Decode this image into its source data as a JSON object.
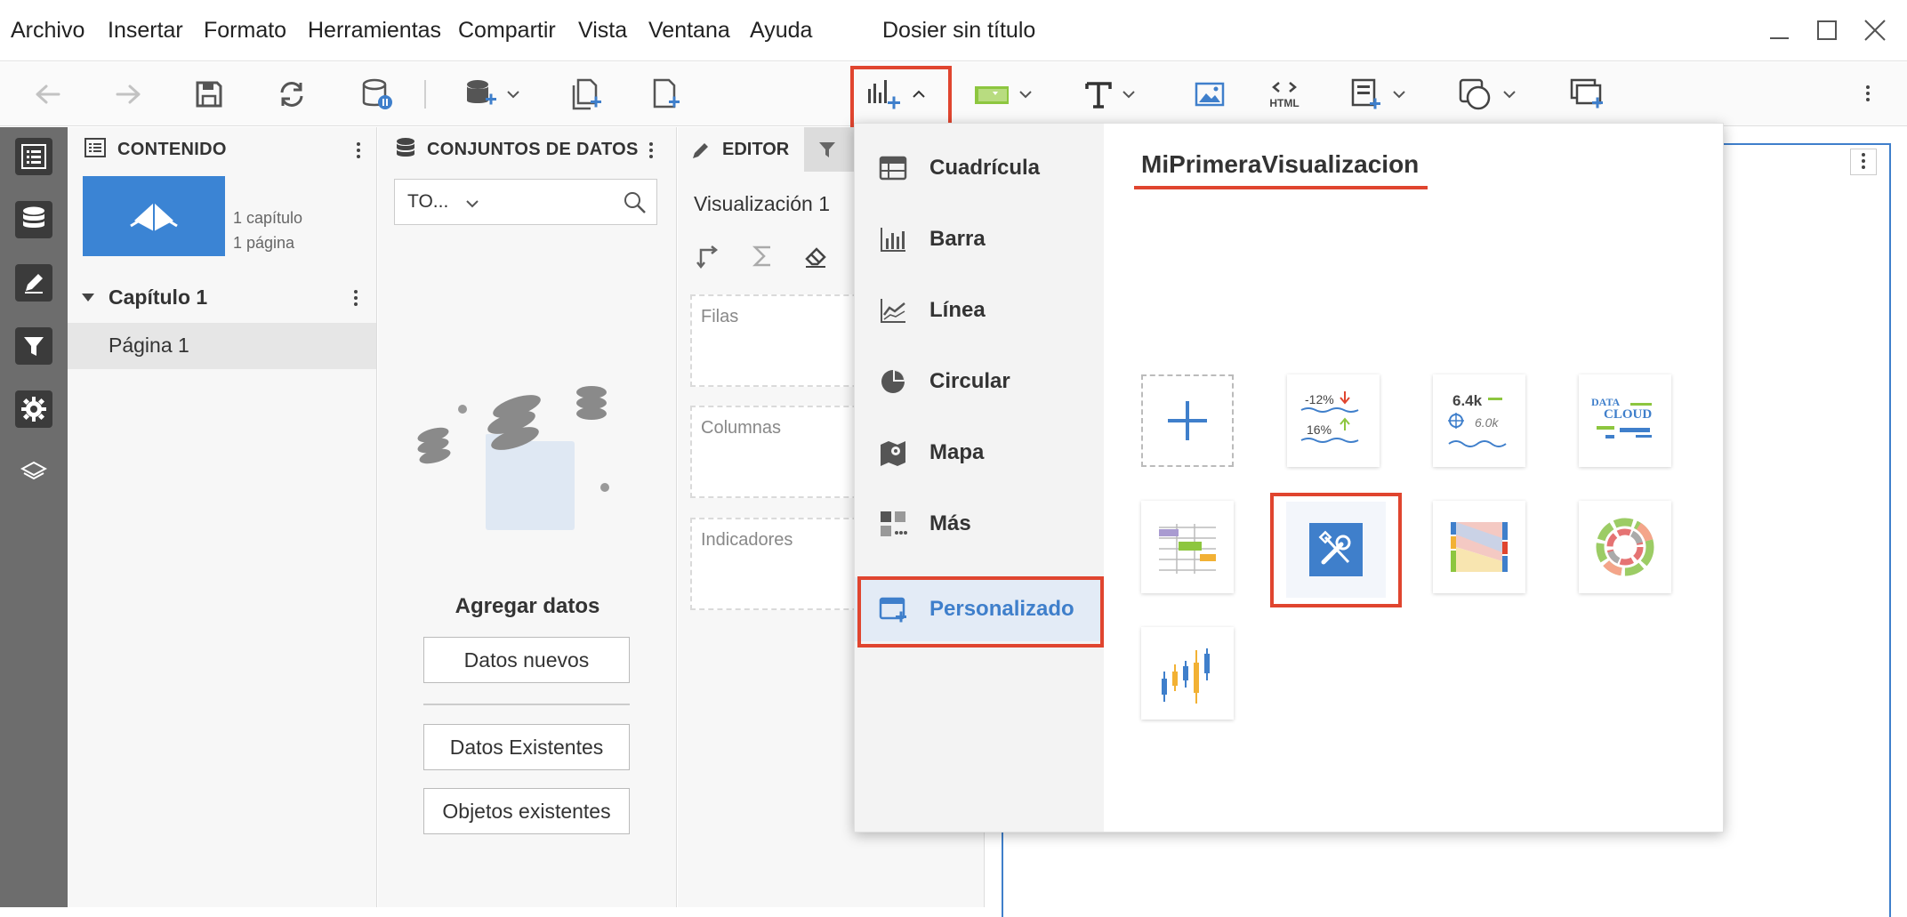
{
  "menubar": {
    "items": [
      "Archivo",
      "Insertar",
      "Formato",
      "Herramientas",
      "Compartir",
      "Vista",
      "Ventana",
      "Ayuda"
    ],
    "doc_title": "Dosier sin título"
  },
  "toolbar": {
    "icons": [
      "undo-icon",
      "redo-icon",
      "save-icon",
      "refresh-icon",
      "data-pause-icon",
      "add-data-icon",
      "duplicate-page-icon",
      "new-page-icon",
      "insert-visualization-icon",
      "filter-icon",
      "text-icon",
      "image-icon",
      "html-icon",
      "panel-stack-icon",
      "shapes-icon",
      "copy-icon",
      "more-icon"
    ],
    "html_label": "HTML"
  },
  "contents": {
    "title": "CONTENIDO",
    "thumb_chapters": "1 capítulo",
    "thumb_pages": "1 página",
    "chapter": "Capítulo 1",
    "page": "Página 1"
  },
  "datasets": {
    "title": "CONJUNTOS DE DATOS",
    "filter_value": "TO...",
    "add_data_title": "Agregar datos",
    "btn_new": "Datos nuevos",
    "btn_existing": "Datos Existentes",
    "btn_objects": "Objetos existentes"
  },
  "editor": {
    "tab": "EDITOR",
    "viz_name": "Visualización 1",
    "zones": [
      "Filas",
      "Columnas",
      "Indicadores"
    ]
  },
  "dropdown": {
    "categories": [
      "Cuadrícula",
      "Barra",
      "Línea",
      "Circular",
      "Mapa",
      "Más",
      "Personalizado"
    ],
    "selected": "Personalizado",
    "gallery_title": "MiPrimeraVisualizacion",
    "kpi_tile": {
      "top": "-12%",
      "bottom": "16%"
    },
    "stat_tile": {
      "top": "6.4k",
      "bottom": "6.0k"
    },
    "cloud_tile": {
      "line1": "DATA",
      "line2": "CLOUD"
    }
  },
  "colors": {
    "accent_blue": "#3f7fcb",
    "highlight_red": "#e0452f",
    "rail_gray": "#6d6d6d"
  }
}
